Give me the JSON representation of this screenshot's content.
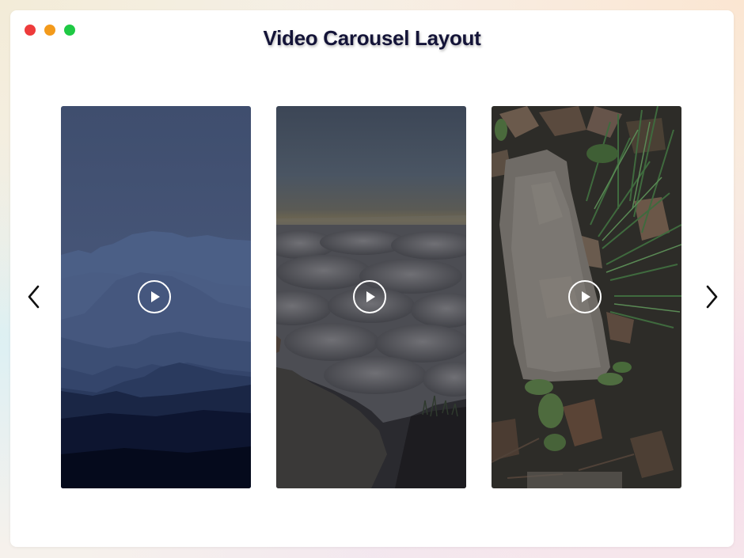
{
  "window": {
    "title": "Video Carousel Layout",
    "traffic_lights": [
      {
        "name": "close",
        "color": "#ee3b3b"
      },
      {
        "name": "minimize",
        "color": "#f39a1b"
      },
      {
        "name": "maximize",
        "color": "#1fc944"
      }
    ]
  },
  "carousel": {
    "prev_icon": "chevron-left-icon",
    "next_icon": "chevron-right-icon",
    "slides": [
      {
        "scene": "misty-blue-mountains",
        "icon": "play-icon"
      },
      {
        "scene": "sea-of-clouds-at-dusk",
        "icon": "play-icon"
      },
      {
        "scene": "stone-on-forest-floor",
        "icon": "play-icon"
      }
    ]
  },
  "colors": {
    "title_text": "#141438",
    "play_icon": "#ffffff",
    "arrow": "#111111"
  }
}
